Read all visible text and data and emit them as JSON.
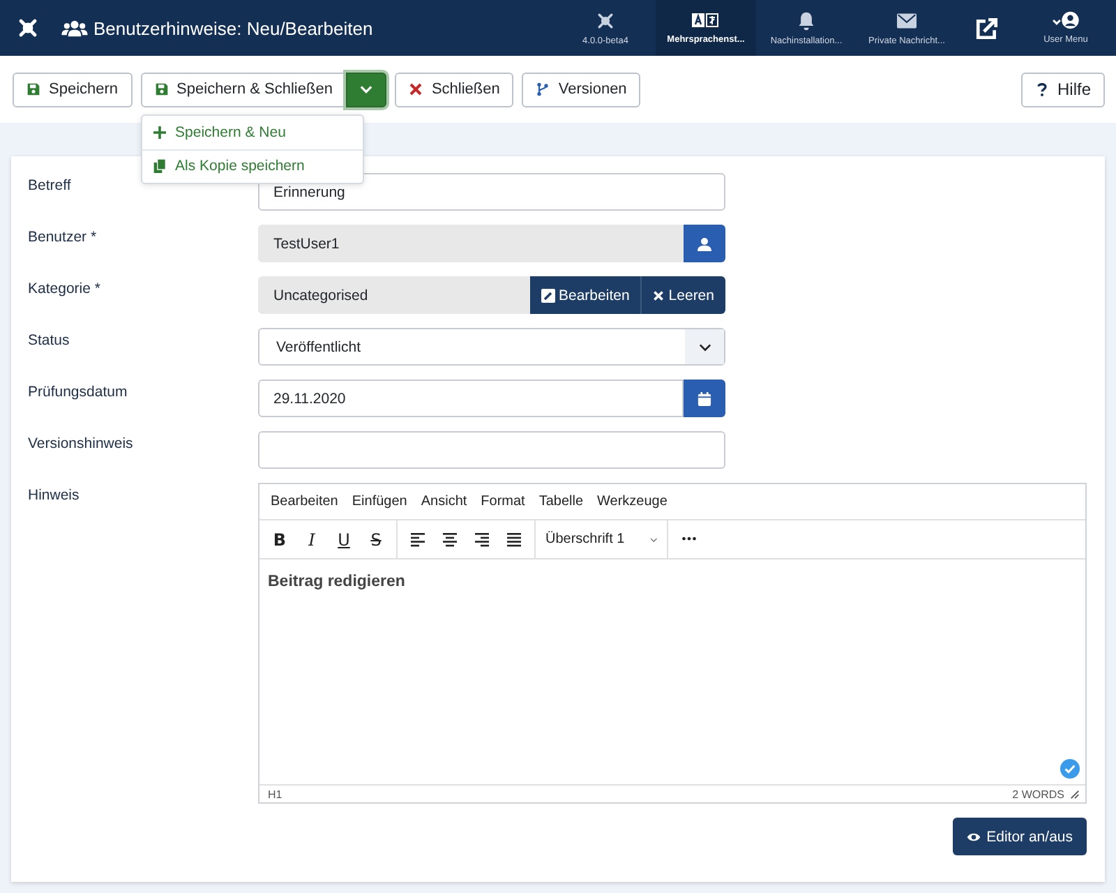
{
  "header": {
    "title": "Benutzerhinweise: Neu/Bearbeiten",
    "items": [
      {
        "kind": "logo",
        "label": "4.0.0-beta4",
        "bold": false
      },
      {
        "kind": "language",
        "label": "Mehrsprachenst...",
        "bold": true
      },
      {
        "kind": "bell",
        "label": "Nachinstallation...",
        "bold": false
      },
      {
        "kind": "mail",
        "label": "Private Nachricht...",
        "bold": false
      },
      {
        "kind": "external",
        "bold": false
      },
      {
        "kind": "user",
        "label": "User Menu",
        "bold": false
      }
    ]
  },
  "toolbar": {
    "buttons": [
      {
        "kind": "save",
        "label": "Speichern"
      },
      {
        "kind": "save-close",
        "label": "Speichern & Schließen",
        "expanded": true
      },
      {
        "kind": "close",
        "label": "Schließen"
      },
      {
        "kind": "versions",
        "label": "Versionen"
      }
    ],
    "help": "Hilfe",
    "menu": [
      {
        "kind": "plus",
        "label": "Speichern & Neu"
      },
      {
        "kind": "copy",
        "label": "Als Kopie speichern"
      }
    ]
  },
  "form": {
    "fields": [
      {
        "kind": "text",
        "label": "Betreff",
        "value": "Erinnerung"
      },
      {
        "kind": "user",
        "label": "Benutzer *",
        "value": "TestUser1"
      },
      {
        "kind": "category",
        "label": "Kategorie *",
        "value": "Uncategorised",
        "edit": "Bearbeiten",
        "clear": "Leeren"
      },
      {
        "kind": "select",
        "label": "Status",
        "value": "Veröffentlicht"
      },
      {
        "kind": "date",
        "label": "Prüfungsdatum",
        "value": "29.11.2020"
      },
      {
        "kind": "text",
        "label": "Versionshinweis"
      }
    ],
    "editor": {
      "label": "Hinweis",
      "menus": [
        "Bearbeiten",
        "Einfügen",
        "Ansicht",
        "Format",
        "Tabelle",
        "Werkzeuge"
      ],
      "formats": [
        {
          "kind": "bold",
          "label": "B"
        },
        {
          "kind": "italic",
          "label": "I"
        },
        {
          "kind": "underline",
          "label": "U"
        },
        {
          "kind": "strike",
          "label": "S"
        }
      ],
      "aligns": [
        {
          "kind": "left"
        },
        {
          "kind": "center"
        },
        {
          "kind": "right"
        },
        {
          "kind": "justify"
        }
      ],
      "block": "Überschrift 1",
      "more": "•••",
      "content": "Beitrag redigieren",
      "path": "H1",
      "wordcount": "2 WORDS",
      "toggle": "Editor an/aus"
    }
  }
}
